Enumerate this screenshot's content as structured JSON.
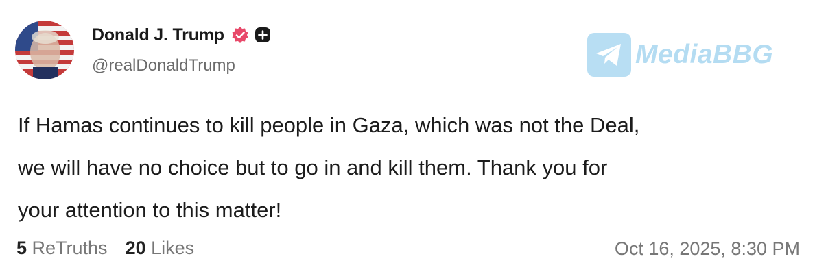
{
  "author": {
    "display_name": "Donald J. Trump",
    "handle": "@realDonaldTrump"
  },
  "watermark": {
    "text": "MediaBBG",
    "icon": "telegram-icon"
  },
  "post": {
    "text_lines": [
      "If Hamas continues to kill people in Gaza, which was not the Deal,",
      "we will have no choice but to go in and kill them. Thank you for",
      "your attention to this matter!"
    ]
  },
  "stats": {
    "retruths_count": "5",
    "retruths_label": "ReTruths",
    "likes_count": "20",
    "likes_label": "Likes"
  },
  "timestamp": "Oct 16, 2025, 8:30 PM",
  "icons": {
    "verified": "verified-badge-icon",
    "add": "plus-icon"
  },
  "colors": {
    "verified_badge": "#e8496a",
    "watermark": "#78c1e8"
  }
}
